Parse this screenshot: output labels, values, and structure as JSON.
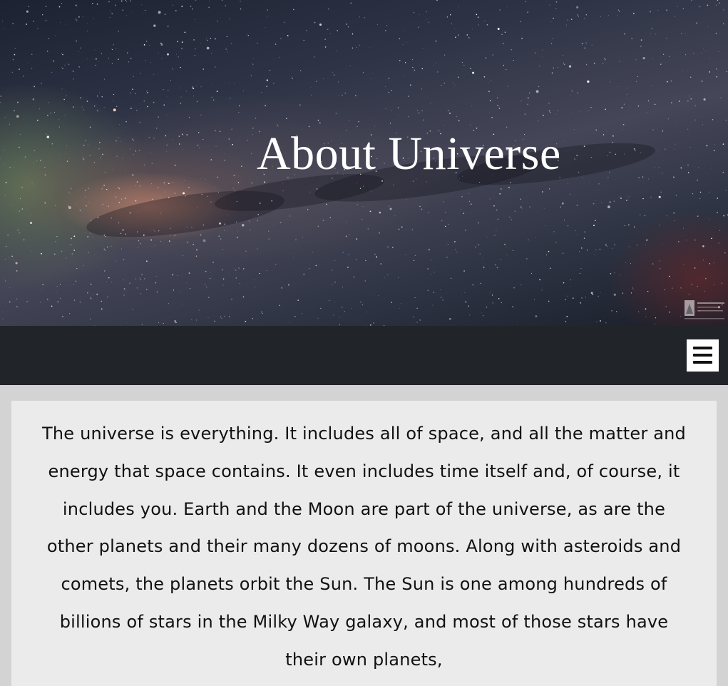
{
  "hero": {
    "title": "About Universe",
    "watermark_text": "Amit Kamble"
  },
  "navbar": {
    "menu_icon": "hamburger-menu-icon"
  },
  "content": {
    "paragraph": "The universe is everything. It includes all of space, and all the matter and energy that space contains. It even includes time itself and, of course, it includes you. Earth and the Moon are part of the universe, as are the other planets and their many dozens of moons. Along with asteroids and comets, the planets orbit the Sun. The Sun is one among hundreds of billions of stars in the Milky Way galaxy, and most of those stars have their own planets,"
  },
  "colors": {
    "navbar_bg": "#212529",
    "page_bg": "#d3d3d3",
    "content_bg": "#ebebeb",
    "title_color": "#ffffff"
  }
}
